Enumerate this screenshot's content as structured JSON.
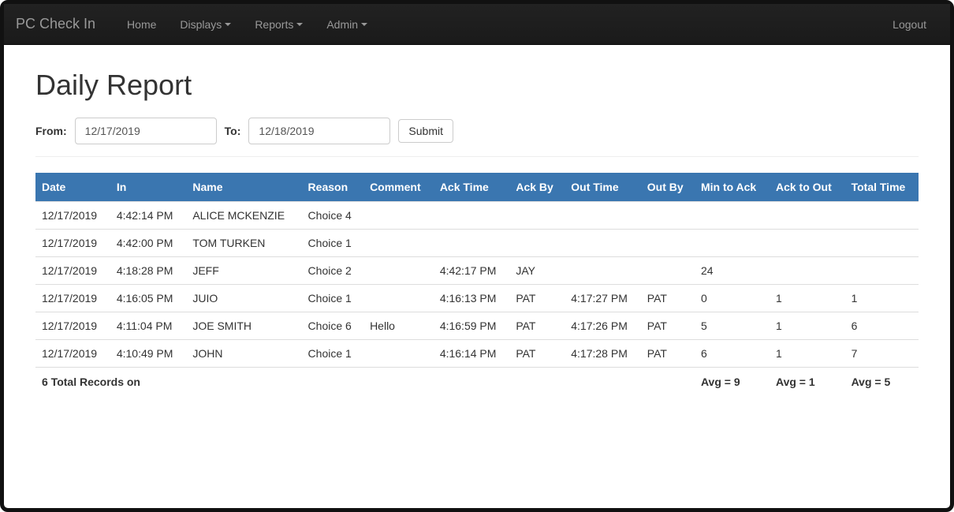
{
  "navbar": {
    "brand": "PC Check In",
    "links": [
      {
        "label": "Home",
        "dropdown": false
      },
      {
        "label": "Displays",
        "dropdown": true
      },
      {
        "label": "Reports",
        "dropdown": true
      },
      {
        "label": "Admin",
        "dropdown": true
      }
    ],
    "logout": "Logout"
  },
  "page": {
    "title": "Daily Report",
    "from_label": "From:",
    "from_value": "12/17/2019",
    "to_label": "To:",
    "to_value": "12/18/2019",
    "submit_label": "Submit"
  },
  "table": {
    "headers": [
      "Date",
      "In",
      "Name",
      "Reason",
      "Comment",
      "Ack Time",
      "Ack By",
      "Out Time",
      "Out By",
      "Min to Ack",
      "Ack to Out",
      "Total Time"
    ],
    "rows": [
      {
        "date": "12/17/2019",
        "in": "4:42:14 PM",
        "name": "ALICE MCKENZIE",
        "reason": "Choice 4",
        "comment": "",
        "ack_time": "",
        "ack_by": "",
        "out_time": "",
        "out_by": "",
        "min_to_ack": "",
        "ack_to_out": "",
        "total_time": ""
      },
      {
        "date": "12/17/2019",
        "in": "4:42:00 PM",
        "name": "TOM TURKEN",
        "reason": "Choice 1",
        "comment": "",
        "ack_time": "",
        "ack_by": "",
        "out_time": "",
        "out_by": "",
        "min_to_ack": "",
        "ack_to_out": "",
        "total_time": ""
      },
      {
        "date": "12/17/2019",
        "in": "4:18:28 PM",
        "name": "JEFF",
        "reason": "Choice 2",
        "comment": "",
        "ack_time": "4:42:17 PM",
        "ack_by": "JAY",
        "out_time": "",
        "out_by": "",
        "min_to_ack": "24",
        "ack_to_out": "",
        "total_time": ""
      },
      {
        "date": "12/17/2019",
        "in": "4:16:05 PM",
        "name": "JUIO",
        "reason": "Choice 1",
        "comment": "",
        "ack_time": "4:16:13 PM",
        "ack_by": "PAT",
        "out_time": "4:17:27 PM",
        "out_by": "PAT",
        "min_to_ack": "0",
        "ack_to_out": "1",
        "total_time": "1"
      },
      {
        "date": "12/17/2019",
        "in": "4:11:04 PM",
        "name": "JOE SMITH",
        "reason": "Choice 6",
        "comment": "Hello",
        "ack_time": "4:16:59 PM",
        "ack_by": "PAT",
        "out_time": "4:17:26 PM",
        "out_by": "PAT",
        "min_to_ack": "5",
        "ack_to_out": "1",
        "total_time": "6"
      },
      {
        "date": "12/17/2019",
        "in": "4:10:49 PM",
        "name": "JOHN",
        "reason": "Choice 1",
        "comment": "",
        "ack_time": "4:16:14 PM",
        "ack_by": "PAT",
        "out_time": "4:17:28 PM",
        "out_by": "PAT",
        "min_to_ack": "6",
        "ack_to_out": "1",
        "total_time": "7"
      }
    ],
    "footer": {
      "summary": "6 Total Records on",
      "avg_min_to_ack": "Avg = 9",
      "avg_ack_to_out": "Avg = 1",
      "avg_total_time": "Avg = 5"
    }
  }
}
